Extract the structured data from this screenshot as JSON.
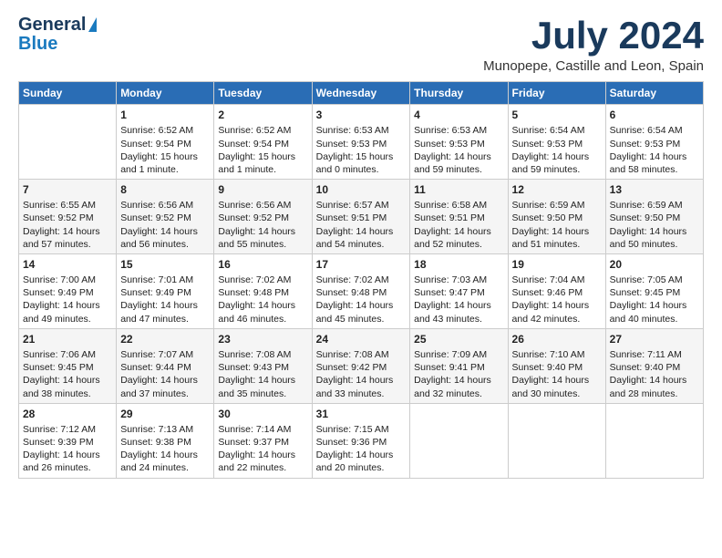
{
  "logo": {
    "line1": "General",
    "line2": "Blue"
  },
  "title": "July 2024",
  "location": "Munopepe, Castille and Leon, Spain",
  "headers": [
    "Sunday",
    "Monday",
    "Tuesday",
    "Wednesday",
    "Thursday",
    "Friday",
    "Saturday"
  ],
  "weeks": [
    [
      {
        "day": "",
        "sunrise": "",
        "sunset": "",
        "daylight": ""
      },
      {
        "day": "1",
        "sunrise": "Sunrise: 6:52 AM",
        "sunset": "Sunset: 9:54 PM",
        "daylight": "Daylight: 15 hours and 1 minute."
      },
      {
        "day": "2",
        "sunrise": "Sunrise: 6:52 AM",
        "sunset": "Sunset: 9:54 PM",
        "daylight": "Daylight: 15 hours and 1 minute."
      },
      {
        "day": "3",
        "sunrise": "Sunrise: 6:53 AM",
        "sunset": "Sunset: 9:53 PM",
        "daylight": "Daylight: 15 hours and 0 minutes."
      },
      {
        "day": "4",
        "sunrise": "Sunrise: 6:53 AM",
        "sunset": "Sunset: 9:53 PM",
        "daylight": "Daylight: 14 hours and 59 minutes."
      },
      {
        "day": "5",
        "sunrise": "Sunrise: 6:54 AM",
        "sunset": "Sunset: 9:53 PM",
        "daylight": "Daylight: 14 hours and 59 minutes."
      },
      {
        "day": "6",
        "sunrise": "Sunrise: 6:54 AM",
        "sunset": "Sunset: 9:53 PM",
        "daylight": "Daylight: 14 hours and 58 minutes."
      }
    ],
    [
      {
        "day": "7",
        "sunrise": "Sunrise: 6:55 AM",
        "sunset": "Sunset: 9:52 PM",
        "daylight": "Daylight: 14 hours and 57 minutes."
      },
      {
        "day": "8",
        "sunrise": "Sunrise: 6:56 AM",
        "sunset": "Sunset: 9:52 PM",
        "daylight": "Daylight: 14 hours and 56 minutes."
      },
      {
        "day": "9",
        "sunrise": "Sunrise: 6:56 AM",
        "sunset": "Sunset: 9:52 PM",
        "daylight": "Daylight: 14 hours and 55 minutes."
      },
      {
        "day": "10",
        "sunrise": "Sunrise: 6:57 AM",
        "sunset": "Sunset: 9:51 PM",
        "daylight": "Daylight: 14 hours and 54 minutes."
      },
      {
        "day": "11",
        "sunrise": "Sunrise: 6:58 AM",
        "sunset": "Sunset: 9:51 PM",
        "daylight": "Daylight: 14 hours and 52 minutes."
      },
      {
        "day": "12",
        "sunrise": "Sunrise: 6:59 AM",
        "sunset": "Sunset: 9:50 PM",
        "daylight": "Daylight: 14 hours and 51 minutes."
      },
      {
        "day": "13",
        "sunrise": "Sunrise: 6:59 AM",
        "sunset": "Sunset: 9:50 PM",
        "daylight": "Daylight: 14 hours and 50 minutes."
      }
    ],
    [
      {
        "day": "14",
        "sunrise": "Sunrise: 7:00 AM",
        "sunset": "Sunset: 9:49 PM",
        "daylight": "Daylight: 14 hours and 49 minutes."
      },
      {
        "day": "15",
        "sunrise": "Sunrise: 7:01 AM",
        "sunset": "Sunset: 9:49 PM",
        "daylight": "Daylight: 14 hours and 47 minutes."
      },
      {
        "day": "16",
        "sunrise": "Sunrise: 7:02 AM",
        "sunset": "Sunset: 9:48 PM",
        "daylight": "Daylight: 14 hours and 46 minutes."
      },
      {
        "day": "17",
        "sunrise": "Sunrise: 7:02 AM",
        "sunset": "Sunset: 9:48 PM",
        "daylight": "Daylight: 14 hours and 45 minutes."
      },
      {
        "day": "18",
        "sunrise": "Sunrise: 7:03 AM",
        "sunset": "Sunset: 9:47 PM",
        "daylight": "Daylight: 14 hours and 43 minutes."
      },
      {
        "day": "19",
        "sunrise": "Sunrise: 7:04 AM",
        "sunset": "Sunset: 9:46 PM",
        "daylight": "Daylight: 14 hours and 42 minutes."
      },
      {
        "day": "20",
        "sunrise": "Sunrise: 7:05 AM",
        "sunset": "Sunset: 9:45 PM",
        "daylight": "Daylight: 14 hours and 40 minutes."
      }
    ],
    [
      {
        "day": "21",
        "sunrise": "Sunrise: 7:06 AM",
        "sunset": "Sunset: 9:45 PM",
        "daylight": "Daylight: 14 hours and 38 minutes."
      },
      {
        "day": "22",
        "sunrise": "Sunrise: 7:07 AM",
        "sunset": "Sunset: 9:44 PM",
        "daylight": "Daylight: 14 hours and 37 minutes."
      },
      {
        "day": "23",
        "sunrise": "Sunrise: 7:08 AM",
        "sunset": "Sunset: 9:43 PM",
        "daylight": "Daylight: 14 hours and 35 minutes."
      },
      {
        "day": "24",
        "sunrise": "Sunrise: 7:08 AM",
        "sunset": "Sunset: 9:42 PM",
        "daylight": "Daylight: 14 hours and 33 minutes."
      },
      {
        "day": "25",
        "sunrise": "Sunrise: 7:09 AM",
        "sunset": "Sunset: 9:41 PM",
        "daylight": "Daylight: 14 hours and 32 minutes."
      },
      {
        "day": "26",
        "sunrise": "Sunrise: 7:10 AM",
        "sunset": "Sunset: 9:40 PM",
        "daylight": "Daylight: 14 hours and 30 minutes."
      },
      {
        "day": "27",
        "sunrise": "Sunrise: 7:11 AM",
        "sunset": "Sunset: 9:40 PM",
        "daylight": "Daylight: 14 hours and 28 minutes."
      }
    ],
    [
      {
        "day": "28",
        "sunrise": "Sunrise: 7:12 AM",
        "sunset": "Sunset: 9:39 PM",
        "daylight": "Daylight: 14 hours and 26 minutes."
      },
      {
        "day": "29",
        "sunrise": "Sunrise: 7:13 AM",
        "sunset": "Sunset: 9:38 PM",
        "daylight": "Daylight: 14 hours and 24 minutes."
      },
      {
        "day": "30",
        "sunrise": "Sunrise: 7:14 AM",
        "sunset": "Sunset: 9:37 PM",
        "daylight": "Daylight: 14 hours and 22 minutes."
      },
      {
        "day": "31",
        "sunrise": "Sunrise: 7:15 AM",
        "sunset": "Sunset: 9:36 PM",
        "daylight": "Daylight: 14 hours and 20 minutes."
      },
      {
        "day": "",
        "sunrise": "",
        "sunset": "",
        "daylight": ""
      },
      {
        "day": "",
        "sunrise": "",
        "sunset": "",
        "daylight": ""
      },
      {
        "day": "",
        "sunrise": "",
        "sunset": "",
        "daylight": ""
      }
    ]
  ]
}
